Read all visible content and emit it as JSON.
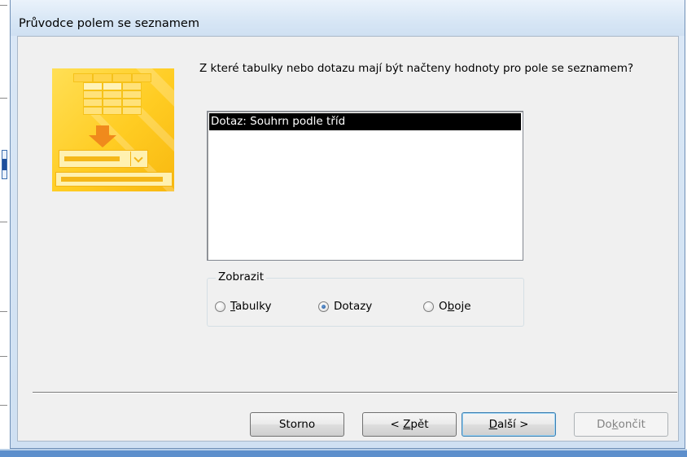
{
  "dialog": {
    "title": "Průvodce polem se seznamem",
    "question": "Z které tabulky nebo dotazu mají být načteny hodnoty pro pole se seznamem?"
  },
  "list": {
    "items": [
      "Dotaz: Souhrn podle tříd"
    ],
    "selected_index": 0
  },
  "view_group": {
    "label": "Zobrazit",
    "options": [
      {
        "pre": "",
        "key": "T",
        "post": "abulky",
        "checked": false
      },
      {
        "pre": "",
        "key": "",
        "post": "Dotazy",
        "checked": true
      },
      {
        "pre": "O",
        "key": "b",
        "post": "oje",
        "checked": false
      }
    ]
  },
  "buttons": {
    "cancel": {
      "pre": "Storno",
      "key": "",
      "post": ""
    },
    "back": {
      "pre": "< ",
      "key": "Z",
      "post": "pět"
    },
    "next": {
      "pre": "",
      "key": "D",
      "post": "alší >"
    },
    "finish": {
      "pre": "Do",
      "key": "k",
      "post": "ončit"
    }
  },
  "colors": {
    "selection_bg": "#000000",
    "selection_fg": "#ffffff",
    "illustration_yellow": "#ffcc22",
    "illustration_arrow": "#f08a1c",
    "default_button_border": "#3c7fb1"
  },
  "icons": {
    "illustration": "combo-box-wizard-illustration"
  }
}
